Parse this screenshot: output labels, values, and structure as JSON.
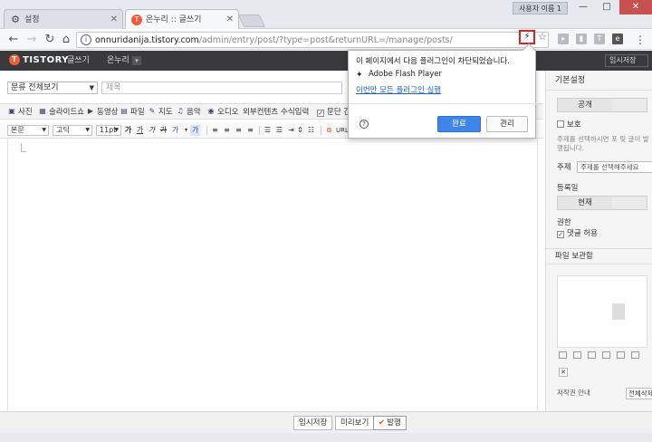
{
  "browser": {
    "tabs": [
      {
        "title": "설정",
        "icon": "gear-icon",
        "active": false
      },
      {
        "title": "온누리 :: 글쓰기",
        "icon": "tistory-favicon",
        "active": true
      }
    ],
    "user_badge": "사용자 이름 1",
    "window_controls": {
      "minimize": "—",
      "maximize": "□",
      "close": "✕"
    },
    "url_host": "onnuridanija.tistory.com",
    "url_path": "/admin/entry/post/?type=post&returnURL=/manage/posts/",
    "ghost_text_left": "",
    "ghost_text_right": ""
  },
  "app": {
    "logo": "TISTORY",
    "logo_mark": "T",
    "page_label": "글쓰기",
    "blog_selector": "온누리",
    "temp_posts": "임시저장"
  },
  "editor": {
    "category": "분류 전체보기",
    "title_placeholder": "제목",
    "attach_tools": [
      {
        "label": "사진",
        "icon": "photo-icon"
      },
      {
        "label": "슬라이드쇼",
        "icon": "slideshow-icon"
      },
      {
        "label": "동영상",
        "icon": "video-icon"
      },
      {
        "label": "파일",
        "icon": "file-icon"
      },
      {
        "label": "지도",
        "icon": "map-icon"
      },
      {
        "label": "음악",
        "icon": "music-icon"
      },
      {
        "label": "오디오",
        "icon": "audio-icon"
      },
      {
        "label": "외부컨텐츠",
        "icon": "external-content-icon"
      },
      {
        "label": "수식입력",
        "icon": "formula-icon"
      },
      {
        "label": "문단 간",
        "icon": "paragraph-checkbox-icon"
      }
    ],
    "format": {
      "paragraph": "본문",
      "font": "고딕",
      "size": "11pt",
      "url_label": "URL"
    }
  },
  "bottom": {
    "save_draft": "임시저장",
    "preview": "미리보기",
    "publish": "발행"
  },
  "sidebar": {
    "header": "기본설정",
    "visibility_selected": "공개",
    "protect_label": "보호",
    "protect_note": "주제를 선택하시면 포 및 글이 발행됩니다.",
    "topic_label": "주제",
    "topic_placeholder": "주제를 선택해주세요",
    "date_label": "등록일",
    "date_selected": "현재",
    "permission_label": "권한",
    "allow_comments": "댓글 허용",
    "file_box_header": "파일 보관함",
    "copyright_label": "저작권 안내",
    "copyright_value": "전체삭제"
  },
  "popover": {
    "message": "이 페이지에서 다음 플러그인이 차단되었습니다.",
    "plugin_name": "Adobe Flash Player",
    "run_link": "이번만 모든 플러그인 실행",
    "done_button": "완료",
    "manage_button": "관리",
    "help_icon": "?"
  },
  "colors": {
    "tistory_accent": "#f15c3b",
    "primary_button": "#3d85e8",
    "highlight_border": "#e01f1f",
    "appbar_bg": "#3a3a3c"
  }
}
